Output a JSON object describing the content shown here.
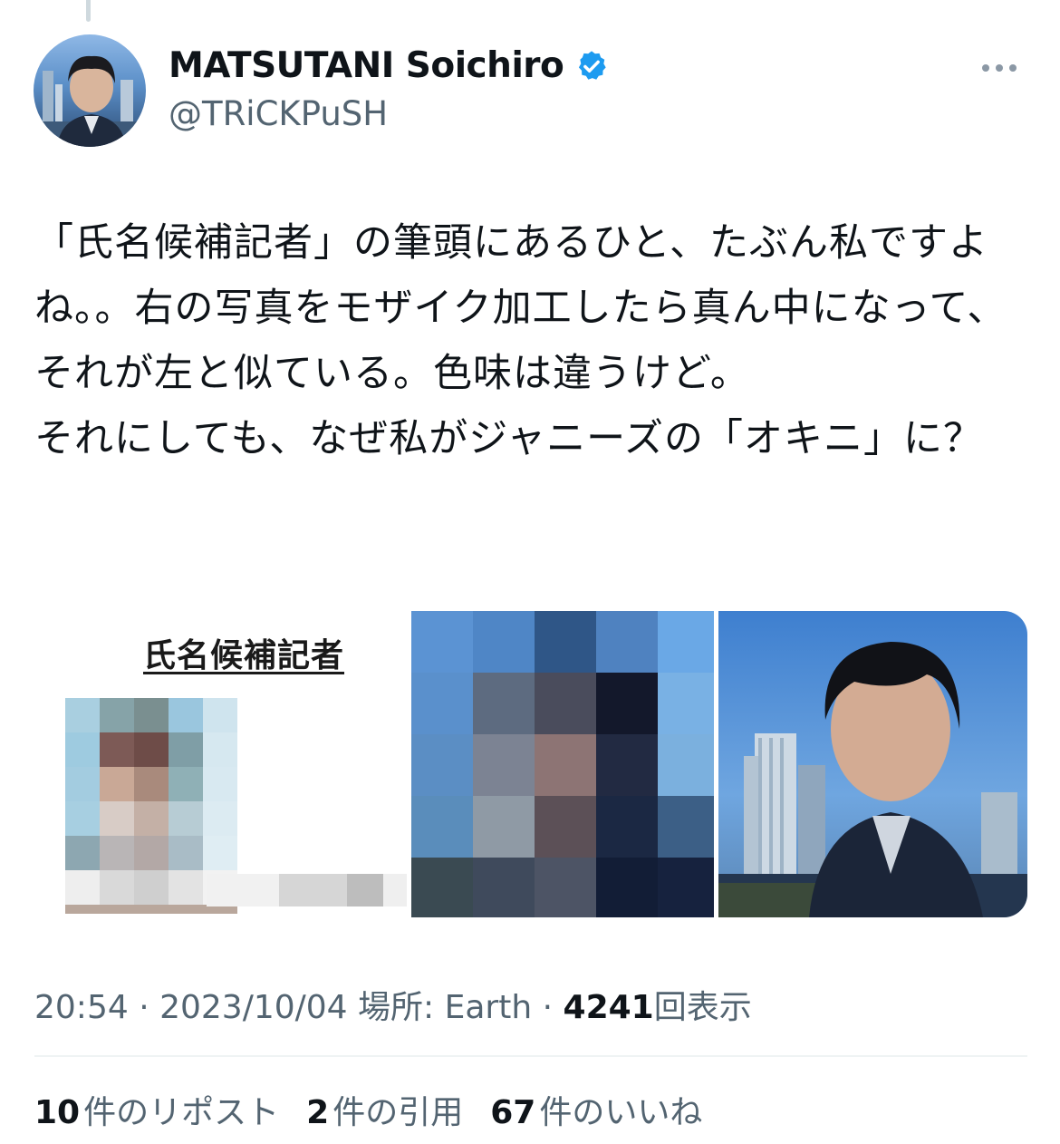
{
  "user": {
    "display_name": "MATSUTANI Soichiro",
    "handle": "@TRiCKPuSH",
    "verified": true
  },
  "tweet": {
    "text": "「氏名候補記者」の筆頭にあるひと、たぶん私ですよね。。右の写真をモザイク加工したら真ん中になって、それが左と似ている。色味は違うけど。\nそれにしても、なぜ私がジャニーズの「オキニ」に？",
    "media_left_heading": "氏名候補記者"
  },
  "meta": {
    "time": "20:54",
    "date": "2023/10/04",
    "location_label": "場所: Earth",
    "views_count": "4241",
    "views_label": "回表示"
  },
  "stats": {
    "reposts_count": "10",
    "reposts_label": "件のリポスト",
    "quotes_count": "2",
    "quotes_label": "件の引用",
    "likes_count": "67",
    "likes_label": "件のいいね"
  },
  "colors": {
    "verified_blue": "#1d9bf0",
    "secondary_text": "#536471",
    "primary_text": "#0f1419"
  },
  "icons": [
    "verified-badge-icon",
    "more-options-icon"
  ]
}
